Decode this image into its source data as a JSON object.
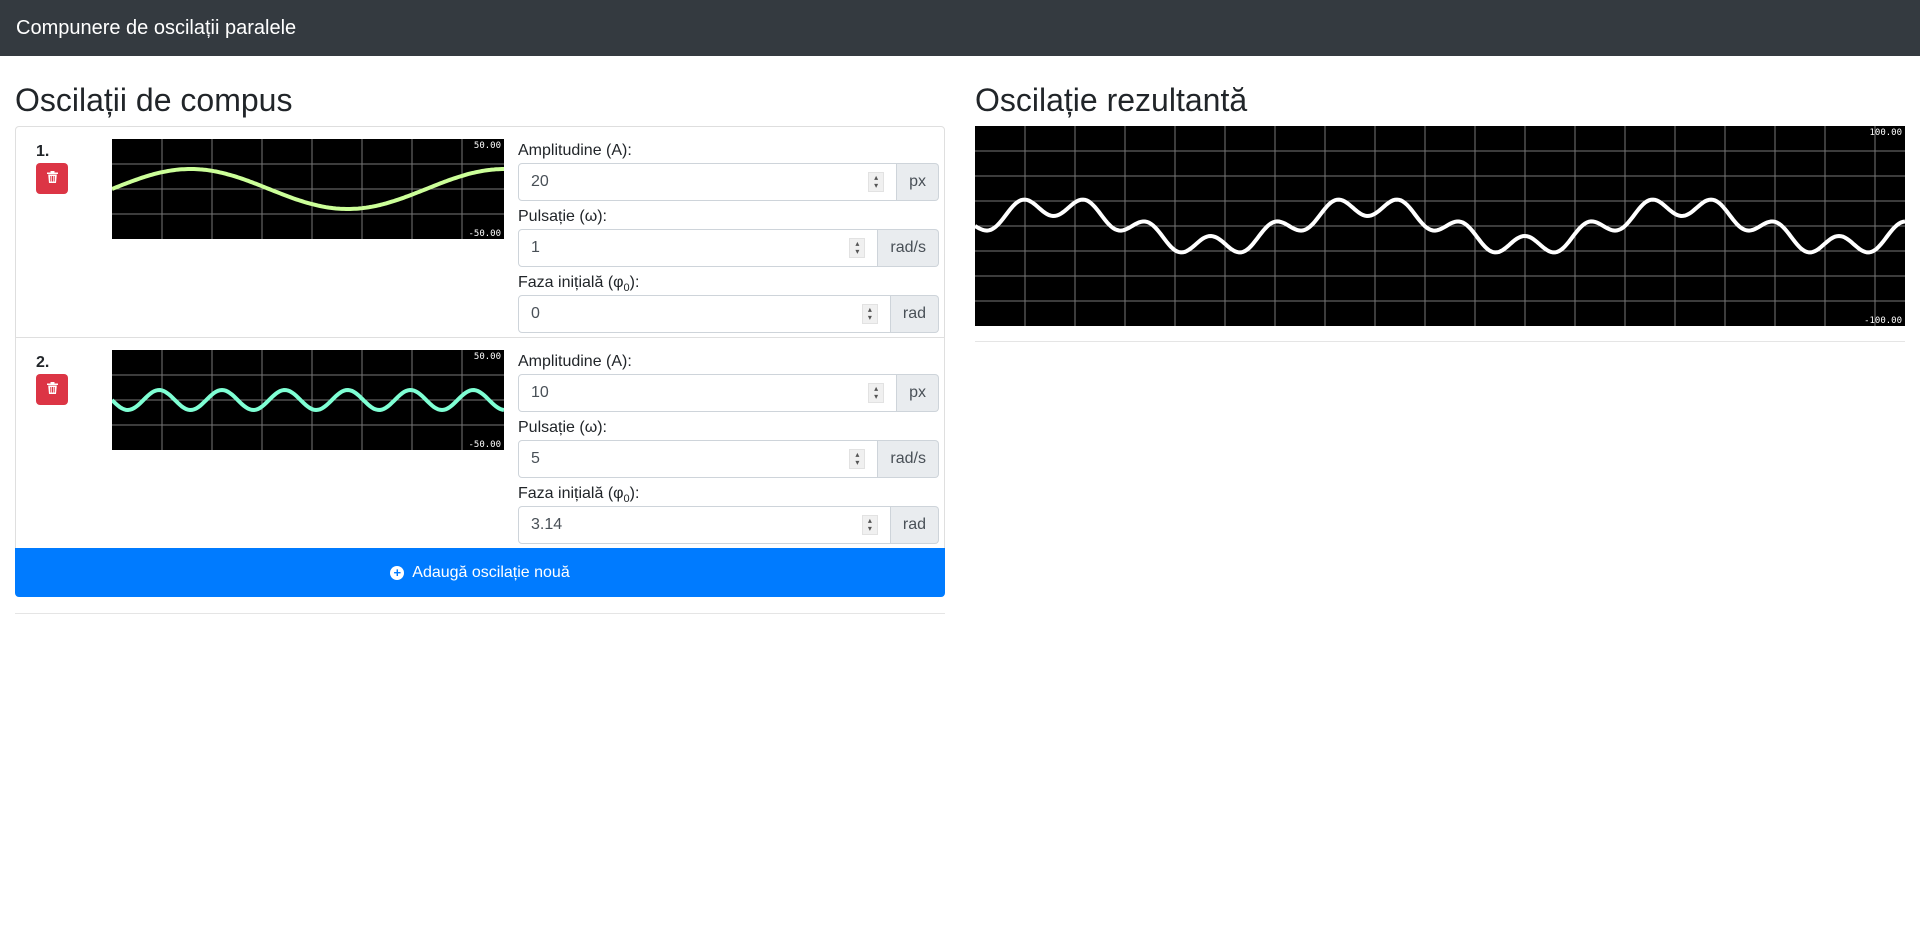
{
  "app": {
    "title": "Compunere de oscilații paralele"
  },
  "left": {
    "heading": "Oscilații de compus",
    "oscillations": [
      {
        "index": "1.",
        "color": "#ccff99",
        "amplitude": {
          "label": "Amplitudine (A):",
          "value": "20",
          "unit": "px"
        },
        "pulsation": {
          "label": "Pulsație (ω):",
          "value": "1",
          "unit": "rad/s"
        },
        "phase": {
          "label_prefix": "Faza inițială (φ",
          "label_sub": "0",
          "label_suffix": "):",
          "value": "0",
          "unit": "rad"
        },
        "scale_max": "50.00",
        "scale_min": "-50.00",
        "delete_icon": "trash-icon"
      },
      {
        "index": "2.",
        "color": "#7fffd4",
        "amplitude": {
          "label": "Amplitudine (A):",
          "value": "10",
          "unit": "px"
        },
        "pulsation": {
          "label": "Pulsație (ω):",
          "value": "5",
          "unit": "rad/s"
        },
        "phase": {
          "label_prefix": "Faza inițială (φ",
          "label_sub": "0",
          "label_suffix": "):",
          "value": "3.14",
          "unit": "rad"
        },
        "scale_max": "50.00",
        "scale_min": "-50.00",
        "delete_icon": "trash-icon"
      }
    ],
    "add_button": {
      "label": "Adaugă oscilație nouă",
      "icon": "plus-circle-icon"
    }
  },
  "right": {
    "heading": "Oscilație rezultantă",
    "scale_max": "100.00",
    "scale_min": "-100.00",
    "color": "#ffffff"
  }
}
